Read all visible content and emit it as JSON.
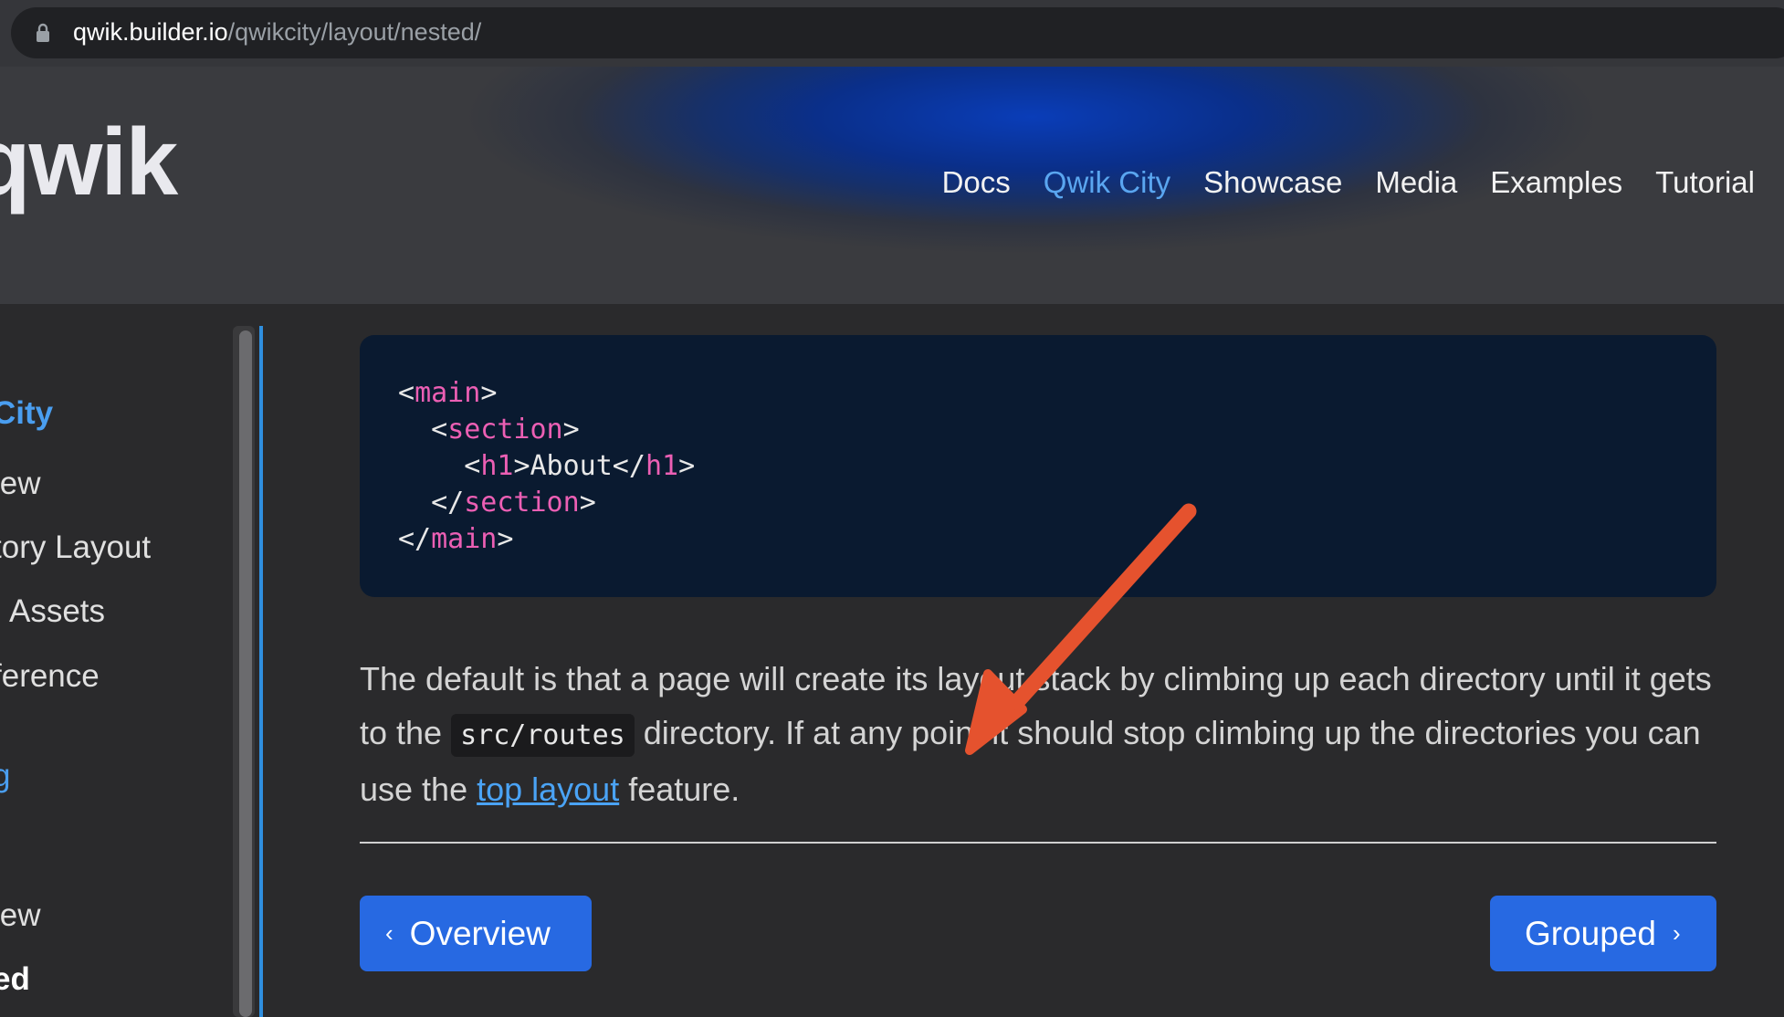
{
  "browser": {
    "url_host": "qwik.builder.io",
    "url_path": "/qwikcity/layout/nested/"
  },
  "header": {
    "logo": "qwik",
    "nav": [
      "Docs",
      "Qwik City",
      "Showcase",
      "Media",
      "Examples",
      "Tutorial"
    ],
    "active_nav": "Qwik City"
  },
  "sidebar": {
    "items": [
      {
        "label": "City",
        "style": "blue"
      },
      {
        "label": "iew",
        "style": "normal"
      },
      {
        "label": "tory Layout",
        "style": "normal"
      },
      {
        "label": "Assets",
        "style": "normal"
      },
      {
        "label": "ference",
        "style": "normal"
      },
      {
        "label": "g",
        "style": "blue"
      },
      {
        "label": ":",
        "style": "blue"
      },
      {
        "label": "iew",
        "style": "normal"
      },
      {
        "label": "ed",
        "style": "bold"
      }
    ]
  },
  "code": {
    "lines": [
      {
        "indent": "",
        "open": "<",
        "name": "main",
        "close": ">",
        "inner": ""
      },
      {
        "indent": "  ",
        "open": "<",
        "name": "section",
        "close": ">",
        "inner": ""
      },
      {
        "indent": "    ",
        "open": "<",
        "name": "h1",
        "close": ">",
        "inner": "About</h1>"
      },
      {
        "indent": "  ",
        "open": "</",
        "name": "section",
        "close": ">",
        "inner": ""
      },
      {
        "indent": "",
        "open": "</",
        "name": "main",
        "close": ">",
        "inner": ""
      }
    ]
  },
  "paragraph": {
    "part1": "The default is that a page will create its layout stack by climbing up each directory until it gets to the ",
    "code": "src/routes",
    "part2": " directory. If at any point it should stop climbing up the directories you can use the ",
    "link": "top layout",
    "part3": " feature."
  },
  "pagination": {
    "prev_label": "Overview",
    "next_label": "Grouped",
    "prev_chevron": "‹",
    "next_chevron": "›"
  },
  "colors": {
    "accent_blue": "#2769e2",
    "link_blue": "#4aa3f5",
    "tag_pink": "#ec5fb4",
    "arrow_red": "#e5522e"
  }
}
